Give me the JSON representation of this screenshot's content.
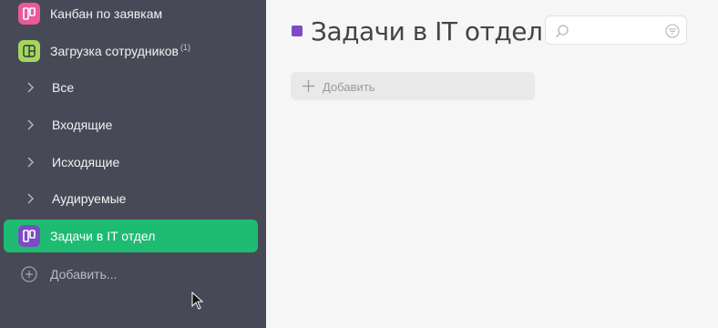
{
  "sidebar": {
    "apps": [
      {
        "label": "Канбан по заявкам",
        "icon": "kanban-board-icon",
        "icon_color": "#e85a9b"
      },
      {
        "label": "Загрузка сотрудников",
        "badge": "(1)",
        "icon": "workload-icon",
        "icon_color": "#a4d65e"
      }
    ],
    "folders": [
      {
        "label": "Все"
      },
      {
        "label": "Входящие"
      },
      {
        "label": "Исходящие"
      },
      {
        "label": "Аудируемые"
      }
    ],
    "active_app": {
      "label": "Задачи в IT отдел",
      "icon": "kanban-board-icon",
      "icon_color": "#7b4cc4"
    },
    "add_label": "Добавить..."
  },
  "main": {
    "title": "Задачи в IT отдел",
    "title_color": "#7b4cc4",
    "search": {
      "placeholder": "",
      "value": ""
    },
    "add_button_label": "Добавить"
  },
  "colors": {
    "sidebar_bg": "#474a56",
    "accent": "#1ebc73"
  }
}
